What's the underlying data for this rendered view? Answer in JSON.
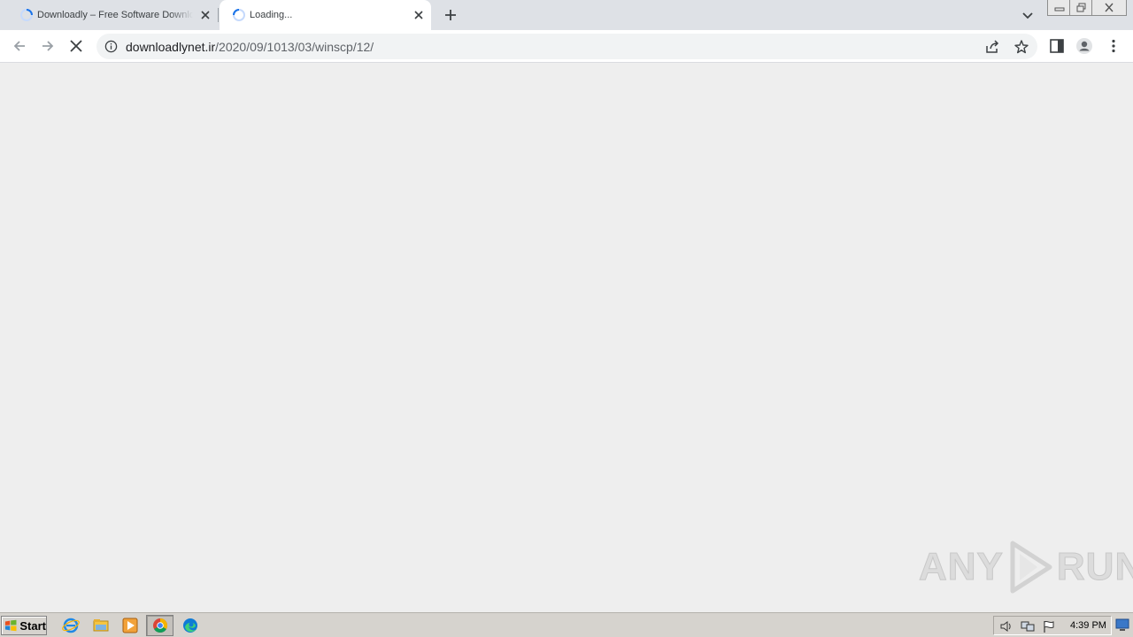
{
  "browser": {
    "tabs": [
      {
        "title": "Downloadly – Free Software Downlo",
        "state": "loading"
      },
      {
        "title": "Loading...",
        "state": "loading",
        "active": true
      }
    ],
    "address": {
      "host": "downloadlynet.ir",
      "path": "/2020/09/1013/03/winscp/12/"
    }
  },
  "watermark": {
    "left": "ANY",
    "right": "RUN"
  },
  "taskbar": {
    "start_label": "Start",
    "clock": "4:39 PM",
    "apps": [
      "internet-explorer-icon",
      "file-explorer-icon",
      "media-player-icon",
      "chrome-icon",
      "edge-icon"
    ]
  },
  "colors": {
    "tabstrip": "#dee1e6",
    "toolbar": "#ffffff",
    "omnibox": "#f1f3f4",
    "content": "#eeeeee",
    "taskbar": "#d6d3ce",
    "spinner": "#1a73e8"
  }
}
